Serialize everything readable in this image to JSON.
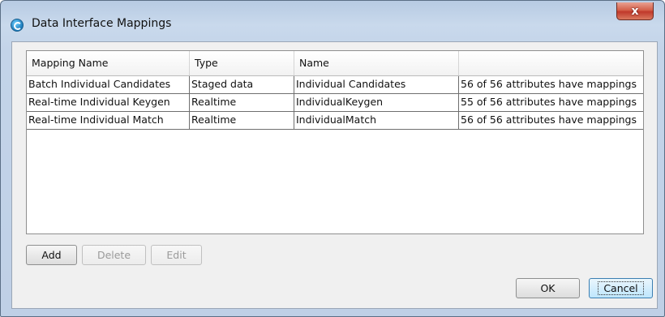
{
  "window": {
    "title": "Data Interface Mappings",
    "close_glyph": "x",
    "icon": "app-logo-icon"
  },
  "table": {
    "headers": [
      "Mapping Name",
      "Type",
      "Name",
      ""
    ],
    "rows": [
      [
        "Batch Individual Candidates",
        "Staged data",
        "Individual Candidates",
        "56 of 56 attributes have mappings"
      ],
      [
        "Real-time Individual Keygen",
        "Realtime",
        "IndividualKeygen",
        "55 of 56 attributes have mappings"
      ],
      [
        "Real-time Individual Match",
        "Realtime",
        "IndividualMatch",
        "56 of 56 attributes have mappings"
      ]
    ]
  },
  "buttons": {
    "add": "Add",
    "delete": "Delete",
    "edit": "Edit",
    "ok": "OK",
    "cancel": "Cancel"
  },
  "colors": {
    "frame": "#c3d4e9",
    "close_button": "#c0392b",
    "focus": "#3c7fb1"
  }
}
